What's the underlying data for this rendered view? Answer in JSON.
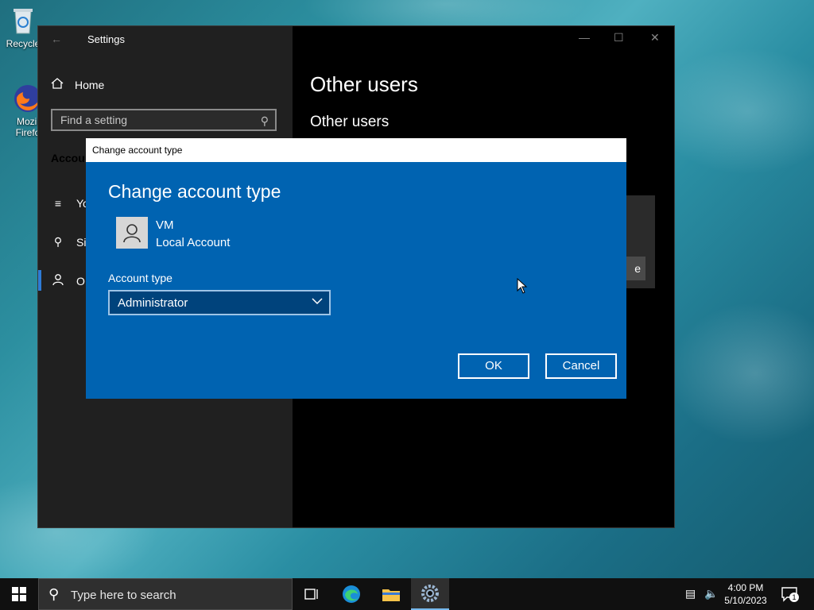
{
  "desktop": {
    "icons": [
      {
        "label": "Recycle"
      },
      {
        "label": "Mozil\nFirefo"
      }
    ]
  },
  "settings": {
    "window_title": "Settings",
    "home_label": "Home",
    "search_placeholder": "Find a setting",
    "section_heading": "Accou",
    "nav_items": [
      {
        "label": "Yo",
        "icon": "person-card-icon"
      },
      {
        "label": "Si",
        "icon": "key-icon"
      },
      {
        "label": "O",
        "icon": "person-icon"
      }
    ],
    "page_title": "Other users",
    "page_subtitle": "Other users",
    "partial_button_text": "e"
  },
  "dialog": {
    "window_title": "Change account type",
    "heading": "Change account type",
    "user_name": "VM",
    "user_type": "Local Account",
    "account_type_label": "Account type",
    "account_type_value": "Administrator",
    "ok_label": "OK",
    "cancel_label": "Cancel"
  },
  "taskbar": {
    "search_placeholder": "Type here to search",
    "time": "4:00 PM",
    "date": "5/10/2023",
    "notification_count": "1"
  },
  "colors": {
    "dialog_bg": "#0063b1",
    "settings_side": "#202020",
    "accent": "#2e7bd6"
  }
}
